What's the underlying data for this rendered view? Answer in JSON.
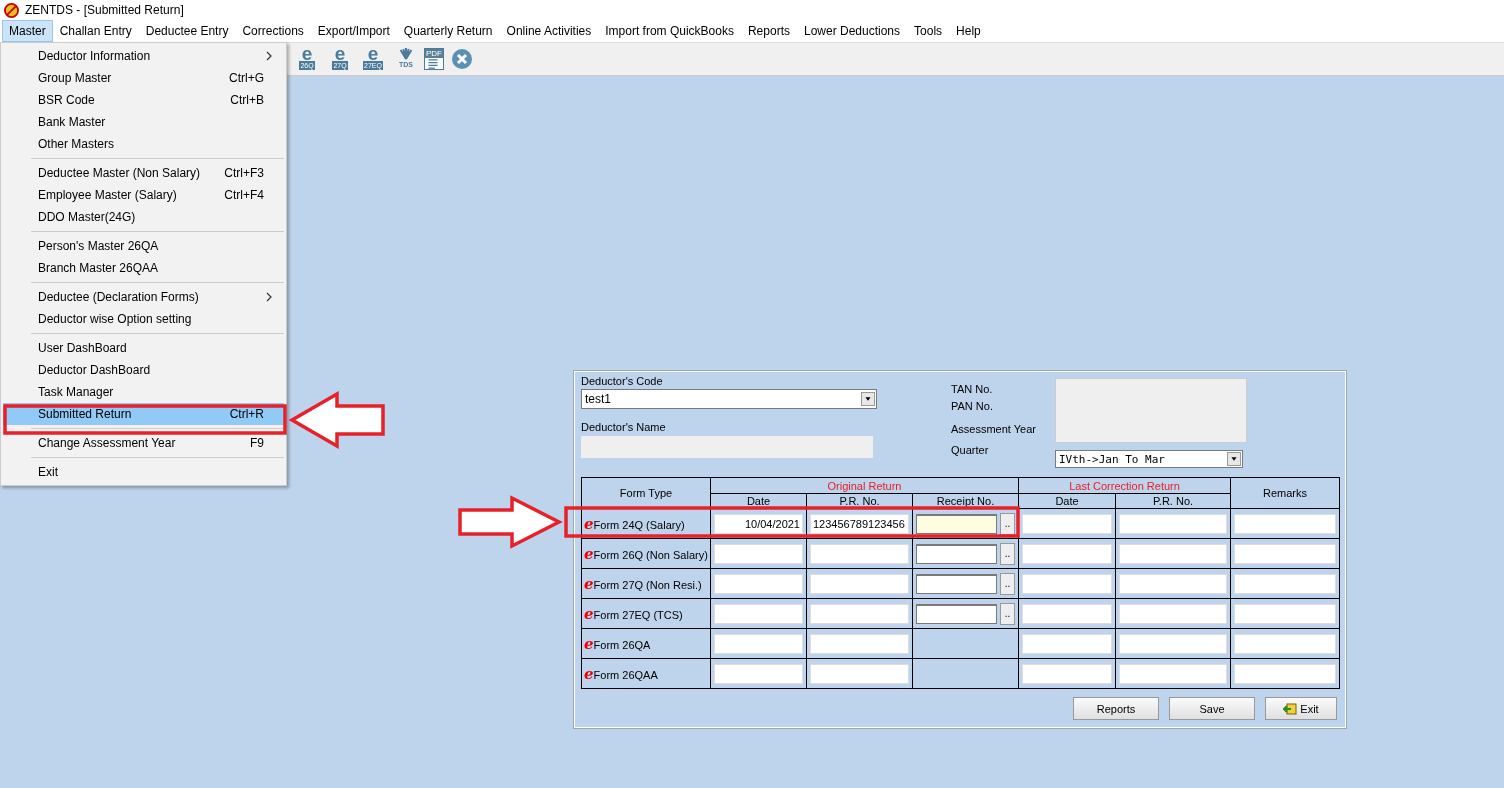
{
  "window": {
    "title": "ZENTDS - [Submitted Return]"
  },
  "menubar": [
    {
      "label": "Master",
      "selected": true
    },
    {
      "label": "Challan Entry",
      "selected": false
    },
    {
      "label": "Deductee Entry",
      "selected": false
    },
    {
      "label": "Corrections",
      "selected": false
    },
    {
      "label": "Export/Import",
      "selected": false
    },
    {
      "label": "Quarterly Return",
      "selected": false
    },
    {
      "label": "Online Activities",
      "selected": false
    },
    {
      "label": "Import from QuickBooks",
      "selected": false
    },
    {
      "label": "Reports",
      "selected": false
    },
    {
      "label": "Lower Deductions",
      "selected": false
    },
    {
      "label": "Tools",
      "selected": false
    },
    {
      "label": "Help",
      "selected": false
    }
  ],
  "toolbar": [
    {
      "kind": "e",
      "glyph": "e",
      "label": "26Q"
    },
    {
      "kind": "e",
      "glyph": "e",
      "label": "27Q"
    },
    {
      "kind": "e",
      "glyph": "e",
      "label": "27EQ"
    },
    {
      "kind": "tds",
      "label": "TDS"
    },
    {
      "kind": "pdf",
      "label": "PDF"
    },
    {
      "kind": "close"
    }
  ],
  "open_menu": {
    "groups": [
      {
        "items": [
          {
            "label": "Deductor Information",
            "submenu": true,
            "selected": false
          },
          {
            "label": "Group Master",
            "shortcut": "Ctrl+G",
            "submenu": false,
            "selected": false
          },
          {
            "label": "BSR Code",
            "shortcut": "Ctrl+B",
            "submenu": false,
            "selected": false
          },
          {
            "label": "Bank Master",
            "submenu": false,
            "selected": false
          },
          {
            "label": "Other Masters",
            "submenu": false,
            "selected": false
          }
        ]
      },
      {
        "items": [
          {
            "label": "Deductee Master (Non Salary)",
            "shortcut": "Ctrl+F3",
            "submenu": false,
            "selected": false
          },
          {
            "label": "Employee Master (Salary)",
            "shortcut": "Ctrl+F4",
            "submenu": false,
            "selected": false
          },
          {
            "label": "DDO Master(24G)",
            "submenu": false,
            "selected": false
          }
        ]
      },
      {
        "items": [
          {
            "label": "Person's Master 26QA",
            "submenu": false,
            "selected": false
          },
          {
            "label": "Branch Master 26QAA",
            "submenu": false,
            "selected": false
          }
        ]
      },
      {
        "items": [
          {
            "label": "Deductee (Declaration Forms)",
            "submenu": true,
            "selected": false
          },
          {
            "label": "Deductor wise Option setting",
            "submenu": false,
            "selected": false
          }
        ]
      },
      {
        "items": [
          {
            "label": "User DashBoard",
            "submenu": false,
            "selected": false
          },
          {
            "label": "Deductor DashBoard",
            "submenu": false,
            "selected": false
          },
          {
            "label": "Task Manager",
            "submenu": false,
            "selected": false
          },
          {
            "label": "Submitted Return",
            "shortcut": "Ctrl+R",
            "submenu": false,
            "selected": true
          }
        ]
      },
      {
        "items": [
          {
            "label": "Change Assessment Year",
            "shortcut": "F9",
            "submenu": false,
            "selected": false
          }
        ]
      },
      {
        "items": [
          {
            "label": "Exit",
            "submenu": false,
            "selected": false
          }
        ]
      }
    ]
  },
  "form": {
    "deductor_code_label": "Deductor's Code",
    "deductor_code": "test1",
    "deductor_name_label": "Deductor's Name",
    "tan_label": "TAN No.",
    "pan_label": "PAN No.",
    "ay_label": "Assessment Year",
    "quarter_label": "Quarter",
    "quarter": "IVth->Jan To Mar"
  },
  "table": {
    "headers": {
      "form_type": "Form Type",
      "original": "Original Return",
      "date": "Date",
      "pr_no": "P.R. No.",
      "receipt": "Receipt No.",
      "last_correction": "Last Correction Return",
      "lc_date": "Date",
      "lc_pr_no": "P.R. No.",
      "remarks": "Remarks"
    },
    "rows": [
      {
        "mark": "e",
        "form": "Form 24Q (Salary)",
        "date": "10/04/2021",
        "pr_no": "123456789123456",
        "receipt": {
          "focused": true,
          "browse": ".."
        }
      },
      {
        "mark": "e",
        "form": "Form 26Q (Non Salary)",
        "receipt": {
          "focused": false,
          "browse": ".."
        }
      },
      {
        "mark": "e",
        "form": "Form 27Q (Non Resi.)",
        "receipt": {
          "focused": false,
          "browse": ".."
        }
      },
      {
        "mark": "e",
        "form": "Form 27EQ (TCS)",
        "receipt": {
          "focused": false,
          "browse": ".."
        }
      },
      {
        "mark": "e",
        "form": "Form 26QA"
      },
      {
        "mark": "e",
        "form": "Form 26QAA"
      }
    ]
  },
  "buttons": [
    {
      "kind": "plain",
      "label": "Reports"
    },
    {
      "kind": "plain",
      "label": "Save"
    },
    {
      "kind": "exit",
      "label": "Exit"
    }
  ]
}
